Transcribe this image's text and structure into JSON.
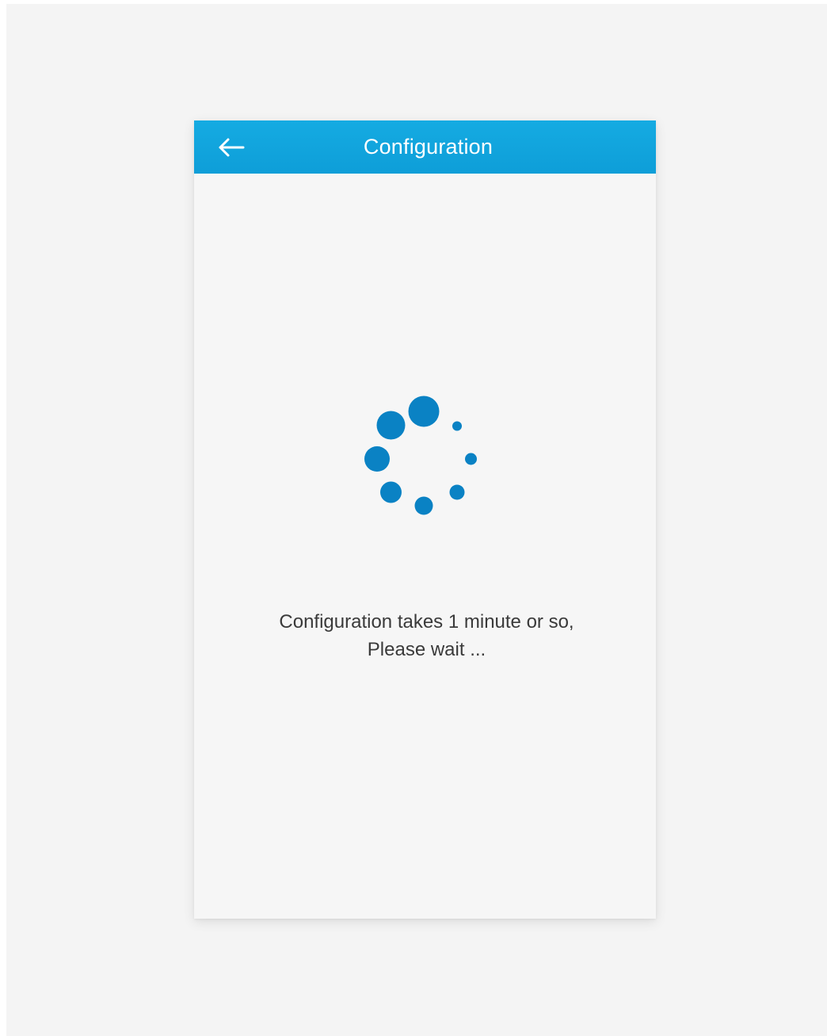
{
  "header": {
    "title": "Configuration",
    "back_icon": "arrow-left-icon",
    "background_color": "#12a6de"
  },
  "loading": {
    "icon": "loading-spinner-icon",
    "color": "#0a82c4"
  },
  "message": {
    "line1": "Configuration takes 1 minute or so,",
    "line2": "Please wait ..."
  }
}
